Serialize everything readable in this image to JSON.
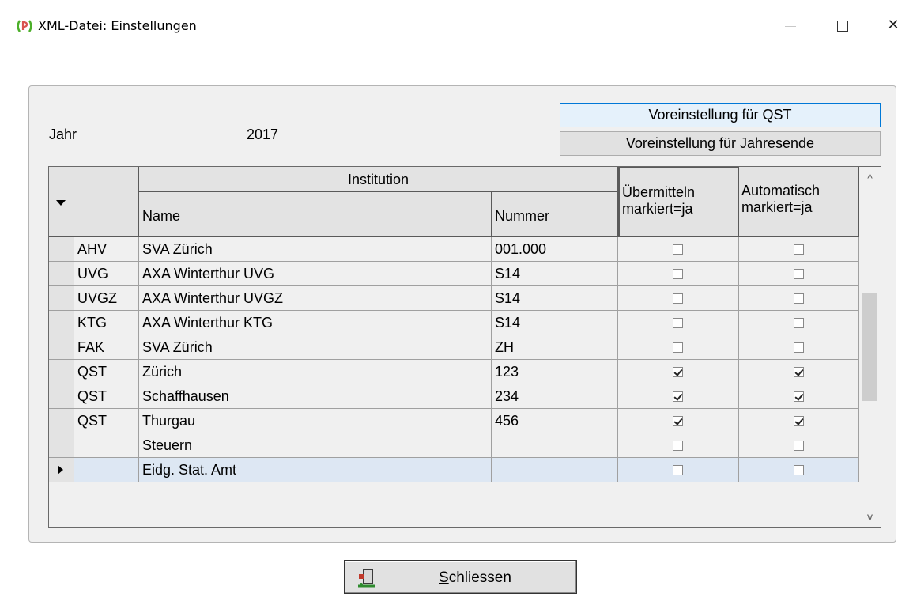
{
  "window": {
    "title": "XML-Datei: Einstellungen",
    "close_glyph": "✕",
    "icon": "app-logo-icon"
  },
  "form": {
    "year_label": "Jahr",
    "year_value": "2017",
    "btn_qst": "Voreinstellung für QST",
    "btn_year_end": "Voreinstellung für Jahresende"
  },
  "grid": {
    "header": {
      "institution": "Institution",
      "name": "Name",
      "number": "Nummer",
      "transmit_line1": "Übermitteln",
      "transmit_line2": "markiert=ja",
      "auto_line1": "Automatisch",
      "auto_line2": "markiert=ja"
    },
    "rows": [
      {
        "code": "AHV",
        "name": "SVA Zürich",
        "number": "001.000",
        "transmit": false,
        "auto": false
      },
      {
        "code": "UVG",
        "name": "AXA Winterthur UVG",
        "number": "S14",
        "transmit": false,
        "auto": false
      },
      {
        "code": "UVGZ",
        "name": "AXA Winterthur UVGZ",
        "number": "S14",
        "transmit": false,
        "auto": false
      },
      {
        "code": "KTG",
        "name": "AXA Winterthur KTG",
        "number": "S14",
        "transmit": false,
        "auto": false
      },
      {
        "code": "FAK",
        "name": "SVA Zürich",
        "number": "ZH",
        "transmit": false,
        "auto": false
      },
      {
        "code": "QST",
        "name": "Zürich",
        "number": "123",
        "transmit": true,
        "auto": true
      },
      {
        "code": "QST",
        "name": "Schaffhausen",
        "number": "234",
        "transmit": true,
        "auto": true
      },
      {
        "code": "QST",
        "name": "Thurgau",
        "number": "456",
        "transmit": true,
        "auto": true
      },
      {
        "code": "",
        "name": "Steuern",
        "number": "",
        "transmit": false,
        "auto": false
      },
      {
        "code": "",
        "name": "Eidg. Stat. Amt",
        "number": "",
        "transmit": false,
        "auto": false,
        "current": true
      }
    ],
    "scroll_up_glyph": "^",
    "scroll_down_glyph": "v"
  },
  "footer": {
    "close_accel": "S",
    "close_rest": "chliessen",
    "close_icon": "exit-door-icon"
  }
}
